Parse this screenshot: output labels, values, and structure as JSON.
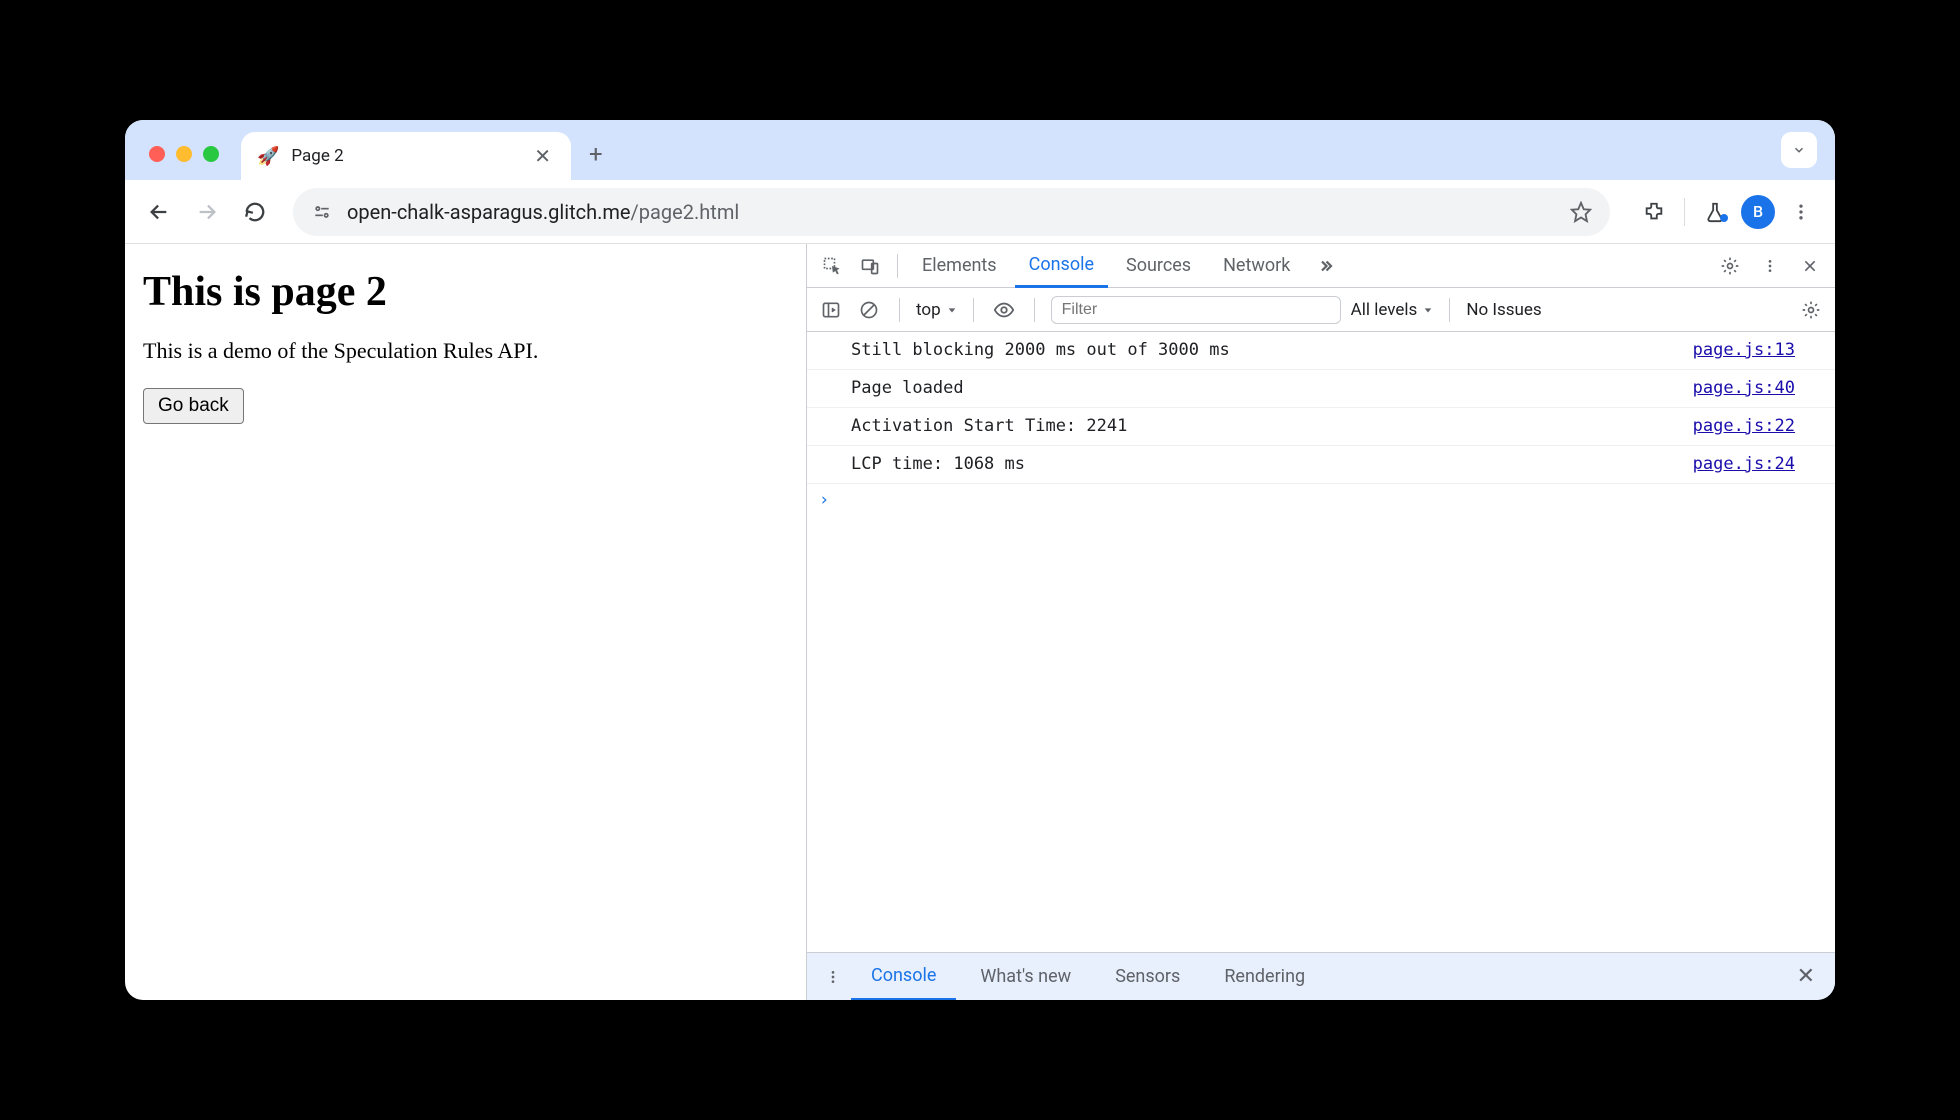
{
  "browser": {
    "tab": {
      "favicon": "🚀",
      "title": "Page 2"
    },
    "url": {
      "host": "open-chalk-asparagus.glitch.me",
      "path": "/page2.html"
    },
    "avatar_initial": "B"
  },
  "page": {
    "heading": "This is page 2",
    "paragraph": "This is a demo of the Speculation Rules API.",
    "back_button": "Go back"
  },
  "devtools": {
    "tabs": {
      "elements": "Elements",
      "console": "Console",
      "sources": "Sources",
      "network": "Network"
    },
    "console_toolbar": {
      "context": "top",
      "filter_placeholder": "Filter",
      "levels": "All levels",
      "issues": "No Issues"
    },
    "logs": [
      {
        "msg": "Still blocking 2000 ms out of 3000 ms",
        "src": "page.js:13"
      },
      {
        "msg": "Page loaded",
        "src": "page.js:40"
      },
      {
        "msg": "Activation Start Time: 2241",
        "src": "page.js:22"
      },
      {
        "msg": "LCP time: 1068 ms",
        "src": "page.js:24"
      }
    ],
    "drawer": {
      "console": "Console",
      "whatsnew": "What's new",
      "sensors": "Sensors",
      "rendering": "Rendering"
    }
  }
}
